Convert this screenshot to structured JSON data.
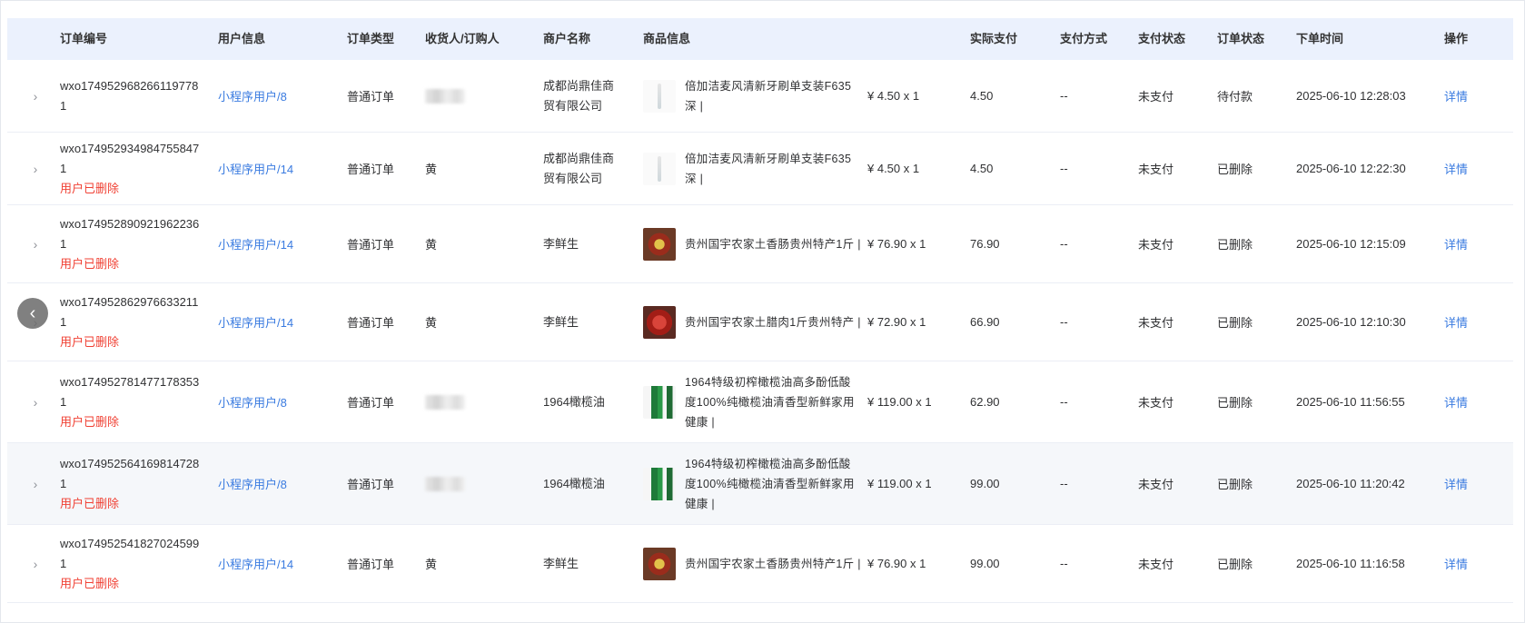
{
  "columns": {
    "order_no": "订单编号",
    "user_info": "用户信息",
    "order_type": "订单类型",
    "receiver": "收货人/订购人",
    "merchant": "商户名称",
    "goods": "商品信息",
    "actual_pay": "实际支付",
    "pay_method": "支付方式",
    "pay_status": "支付状态",
    "order_status": "订单状态",
    "order_time": "下单时间",
    "action": "操作"
  },
  "icons": {
    "expand": "chevron-right-icon",
    "scroll_left": "chevron-left-icon"
  },
  "colors": {
    "header_bg": "#ebf1fd",
    "link": "#3a7be0",
    "deleted": "#f04134"
  },
  "rows": [
    {
      "order_no": "wxo174952968266119778 1",
      "deleted_label": "",
      "user": "小程序用户/8",
      "order_type": "普通订单",
      "receiver": "",
      "receiver_blurred": true,
      "merchant": "成都尚鼎佳商贸有限公司",
      "goods_thumb": "brush",
      "goods_name": "倍加洁麦风清新牙刷单支装F635 深 |",
      "goods_price": "¥ 4.50 x 1",
      "actual_pay": "4.50",
      "pay_method": "--",
      "pay_status": "未支付",
      "order_status": "待付款",
      "order_time": "2025-06-10 12:28:03",
      "action": "详情"
    },
    {
      "order_no": "wxo174952934984755847 1",
      "deleted_label": "用户已删除",
      "user": "小程序用户/14",
      "order_type": "普通订单",
      "receiver": "黄",
      "receiver_blurred": false,
      "merchant": "成都尚鼎佳商贸有限公司",
      "goods_thumb": "brush",
      "goods_name": "倍加洁麦风清新牙刷单支装F635 深 |",
      "goods_price": "¥ 4.50 x 1",
      "actual_pay": "4.50",
      "pay_method": "--",
      "pay_status": "未支付",
      "order_status": "已删除",
      "order_time": "2025-06-10 12:22:30",
      "action": "详情"
    },
    {
      "order_no": "wxo174952890921962236 1",
      "deleted_label": "用户已删除",
      "user": "小程序用户/14",
      "order_type": "普通订单",
      "receiver": "黄",
      "receiver_blurred": false,
      "merchant": "李鲜生",
      "goods_thumb": "sausage",
      "goods_name": "贵州国宇农家土香肠贵州特产1斤 |",
      "goods_price": "¥ 76.90 x 1",
      "actual_pay": "76.90",
      "pay_method": "--",
      "pay_status": "未支付",
      "order_status": "已删除",
      "order_time": "2025-06-10 12:15:09",
      "action": "详情"
    },
    {
      "order_no": "wxo174952862976633211 1",
      "deleted_label": "用户已删除",
      "user": "小程序用户/14",
      "order_type": "普通订单",
      "receiver": "黄",
      "receiver_blurred": false,
      "merchant": "李鲜生",
      "goods_thumb": "pork",
      "goods_name": "贵州国宇农家土腊肉1斤贵州特产 |",
      "goods_price": "¥ 72.90 x 1",
      "actual_pay": "66.90",
      "pay_method": "--",
      "pay_status": "未支付",
      "order_status": "已删除",
      "order_time": "2025-06-10 12:10:30",
      "action": "详情"
    },
    {
      "order_no": "wxo174952781477178353 1",
      "deleted_label": "用户已删除",
      "user": "小程序用户/8",
      "order_type": "普通订单",
      "receiver": "",
      "receiver_blurred": true,
      "merchant": "1964橄榄油",
      "goods_thumb": "oil",
      "goods_name": "1964特级初榨橄榄油高多酚低酸度100%纯橄榄油清香型新鲜家用健康 |",
      "goods_price": "¥ 119.00 x 1",
      "actual_pay": "62.90",
      "pay_method": "--",
      "pay_status": "未支付",
      "order_status": "已删除",
      "order_time": "2025-06-10 11:56:55",
      "action": "详情"
    },
    {
      "order_no": "wxo174952564169814728 1",
      "deleted_label": "用户已删除",
      "user": "小程序用户/8",
      "order_type": "普通订单",
      "receiver": "",
      "receiver_blurred": true,
      "merchant": "1964橄榄油",
      "goods_thumb": "oil",
      "goods_name": "1964特级初榨橄榄油高多酚低酸度100%纯橄榄油清香型新鲜家用健康 |",
      "goods_price": "¥ 119.00 x 1",
      "actual_pay": "99.00",
      "pay_method": "--",
      "pay_status": "未支付",
      "order_status": "已删除",
      "order_time": "2025-06-10 11:20:42",
      "action": "详情"
    },
    {
      "order_no": "wxo174952541827024599 1",
      "deleted_label": "用户已删除",
      "user": "小程序用户/14",
      "order_type": "普通订单",
      "receiver": "黄",
      "receiver_blurred": false,
      "merchant": "李鲜生",
      "goods_thumb": "sausage",
      "goods_name": "贵州国宇农家土香肠贵州特产1斤 |",
      "goods_price": "¥ 76.90 x 1",
      "actual_pay": "99.00",
      "pay_method": "--",
      "pay_status": "未支付",
      "order_status": "已删除",
      "order_time": "2025-06-10 11:16:58",
      "action": "详情"
    }
  ]
}
